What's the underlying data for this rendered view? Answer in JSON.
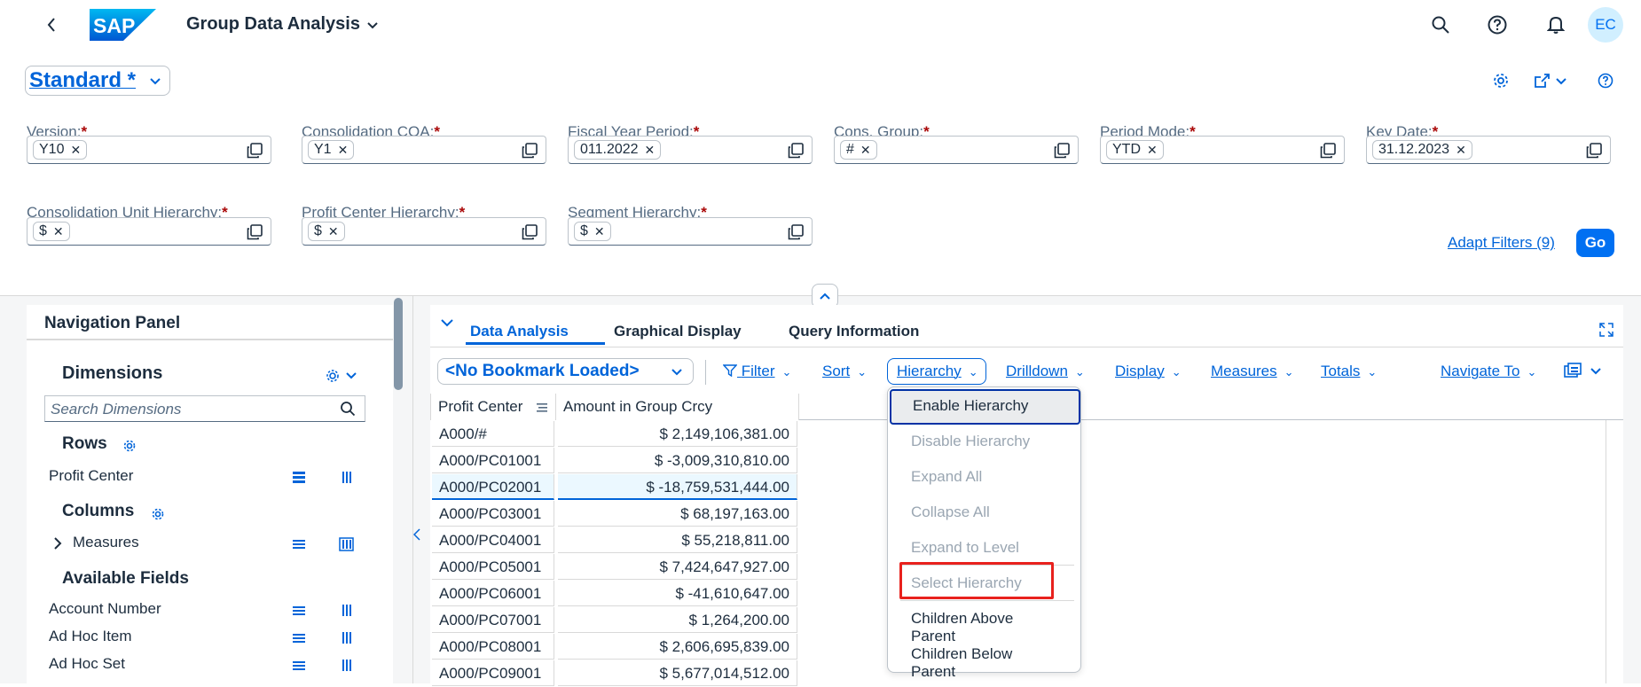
{
  "shell": {
    "app_title": "Group Data Analysis",
    "logo_text": "SAP",
    "avatar_initials": "EC"
  },
  "variant": {
    "title": "Standard *"
  },
  "filters": [
    {
      "label": "Version:",
      "token": "Y10"
    },
    {
      "label": "Consolidation COA:",
      "token": "Y1"
    },
    {
      "label": "Fiscal Year Period:",
      "token": "011.2022"
    },
    {
      "label": "Cons. Group:",
      "token": "#"
    },
    {
      "label": "Period Mode:",
      "token": "YTD"
    },
    {
      "label": "Key Date:",
      "token": "31.12.2023"
    },
    {
      "label": "Consolidation Unit Hierarchy:",
      "token": "$"
    },
    {
      "label": "Profit Center Hierarchy:",
      "token": "$"
    },
    {
      "label": "Segment Hierarchy:",
      "token": "$"
    }
  ],
  "filter_bar": {
    "adapt_label": "Adapt Filters (9)",
    "go_label": "Go"
  },
  "navigation_panel": {
    "title": "Navigation Panel",
    "dimensions_title": "Dimensions",
    "search_placeholder": "Search Dimensions",
    "rows_title": "Rows",
    "rows": [
      "Profit Center"
    ],
    "columns_title": "Columns",
    "columns": [
      "Measures"
    ],
    "available_title": "Available Fields",
    "available": [
      "Account Number",
      "Ad Hoc Item",
      "Ad Hoc Set"
    ]
  },
  "tabs": [
    {
      "label": "Data Analysis",
      "active": true
    },
    {
      "label": "Graphical Display",
      "active": false
    },
    {
      "label": "Query Information",
      "active": false
    }
  ],
  "toolbar": {
    "bookmark": "<No Bookmark Loaded>",
    "buttons": [
      "Filter",
      "Sort",
      "Hierarchy",
      "Drilldown",
      "Display",
      "Measures",
      "Totals",
      "Navigate To"
    ]
  },
  "grid": {
    "headers": [
      "Profit Center",
      "Amount in Group Crcy"
    ],
    "rows": [
      {
        "pc": "A000/#",
        "amount": "$ 2,149,106,381.00"
      },
      {
        "pc": "A000/PC01001",
        "amount": "$ -3,009,310,810.00"
      },
      {
        "pc": "A000/PC02001",
        "amount": "$ -18,759,531,444.00"
      },
      {
        "pc": "A000/PC03001",
        "amount": "$ 68,197,163.00"
      },
      {
        "pc": "A000/PC04001",
        "amount": "$ 55,218,811.00"
      },
      {
        "pc": "A000/PC05001",
        "amount": "$ 7,424,647,927.00"
      },
      {
        "pc": "A000/PC06001",
        "amount": "$ -41,610,647.00"
      },
      {
        "pc": "A000/PC07001",
        "amount": "$ 1,264,200.00"
      },
      {
        "pc": "A000/PC08001",
        "amount": "$ 2,606,695,839.00"
      },
      {
        "pc": "A000/PC09001",
        "amount": "$ 5,677,014,512.00"
      }
    ]
  },
  "hierarchy_menu": {
    "items": [
      {
        "label": "Enable Hierarchy",
        "enabled": true
      },
      {
        "label": "Disable Hierarchy",
        "enabled": false
      },
      {
        "label": "Expand All",
        "enabled": false
      },
      {
        "label": "Collapse All",
        "enabled": false
      },
      {
        "label": "Expand to Level",
        "enabled": false
      },
      {
        "label": "Select Hierarchy",
        "enabled": false
      },
      {
        "label": "Children Above Parent",
        "enabled": true
      },
      {
        "label": "Children Below Parent",
        "enabled": true
      }
    ]
  },
  "colors": {
    "accent": "#0064d9",
    "go_button": "#0070f2",
    "required": "#aa0808",
    "highlight": "#e8211d"
  }
}
